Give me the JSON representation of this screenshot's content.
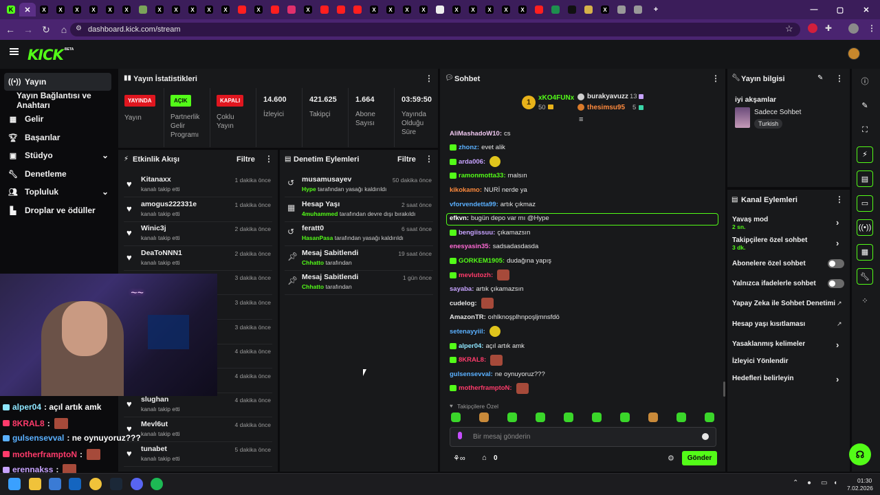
{
  "browser": {
    "url": "dashboard.kick.com/stream"
  },
  "sidebar": {
    "items": [
      {
        "label": "Yayın",
        "icon": "broadcast-icon"
      },
      {
        "label": "Yayın Bağlantısı ve Anahtarı",
        "icon": ""
      },
      {
        "label": "Gelir",
        "icon": "revenue-icon"
      },
      {
        "label": "Başarılar",
        "icon": "trophy-icon"
      },
      {
        "label": "Stüdyo",
        "icon": "studio-icon"
      },
      {
        "label": "Denetleme",
        "icon": "wrench-icon"
      },
      {
        "label": "Topluluk",
        "icon": "community-icon"
      },
      {
        "label": "Droplar ve ödüller",
        "icon": "drops-icon"
      }
    ]
  },
  "stats": {
    "title": "Yayın İstatistikleri",
    "badges": [
      {
        "badge": "YAYINDA",
        "label": "Yayın",
        "color": "#e0161f"
      },
      {
        "badge": "AÇIK",
        "label": "Partnerlik Gelir Programı",
        "color": "#53fc18"
      },
      {
        "badge": "KAPALI",
        "label": "Çoklu Yayın",
        "color": "#e0161f"
      }
    ],
    "numbers": [
      {
        "value": "14.600",
        "label": "İzleyici"
      },
      {
        "value": "421.625",
        "label": "Takipçi"
      },
      {
        "value": "1.664",
        "label": "Abone Sayısı"
      },
      {
        "value": "03:59:50",
        "label": "Yayında Olduğu Süre"
      }
    ]
  },
  "activity": {
    "title": "Etkinlik Akışı",
    "filter": "Filtre",
    "rows": [
      {
        "name": "Kitanaxx",
        "sub": "kanalı takip etti",
        "time": "1 dakika önce"
      },
      {
        "name": "amogus222331e",
        "sub": "kanalı takip etti",
        "time": "1 dakika önce"
      },
      {
        "name": "Winic3j",
        "sub": "kanalı takip etti",
        "time": "2 dakika önce"
      },
      {
        "name": "DeaToNNN1",
        "sub": "kanalı takip etti",
        "time": "2 dakika önce"
      },
      {
        "name": "",
        "sub": "",
        "time": "3 dakika önce"
      },
      {
        "name": "",
        "sub": "",
        "time": "3 dakika önce"
      },
      {
        "name": "",
        "sub": "",
        "time": "3 dakika önce"
      },
      {
        "name": "",
        "sub": "",
        "time": "4 dakika önce"
      },
      {
        "name": "",
        "sub": "",
        "time": "4 dakika önce"
      },
      {
        "name": "slughan",
        "sub": "kanalı takip etti",
        "time": "4 dakika önce"
      },
      {
        "name": "Mevl6ut",
        "sub": "kanalı takip etti",
        "time": "4 dakika önce"
      },
      {
        "name": "tunabet",
        "sub": "kanalı takip etti",
        "time": "5 dakika önce"
      }
    ]
  },
  "moderation": {
    "title": "Denetim Eylemleri",
    "filter": "Filtre",
    "rows": [
      {
        "name": "musamusayev",
        "actor": "Hype",
        "sub": "tarafından yasağı kaldırıldı",
        "time": "50 dakika önce",
        "icon": "undo-icon"
      },
      {
        "name": "Hesap Yaşı",
        "actor": "4muhammed",
        "sub": "tarafından devre dışı bırakıldı",
        "time": "2 saat önce",
        "icon": "calendar-icon"
      },
      {
        "name": "feratt0",
        "actor": "HasanPasa",
        "sub": "tarafından yasağı kaldırıldı",
        "time": "6 saat önce",
        "icon": "undo-icon"
      },
      {
        "name": "Mesaj Sabitlendi",
        "actor": "Chhatto",
        "sub": "tarafından",
        "time": "19 saat önce",
        "icon": "pin-icon"
      },
      {
        "name": "Mesaj Sabitlendi",
        "actor": "Chhatto",
        "sub": "tarafından",
        "time": "1 gün önce",
        "icon": "pin-icon"
      }
    ]
  },
  "chat": {
    "title": "Sohbet",
    "top_gifter": {
      "name": "xKO4FUNx",
      "count": "50"
    },
    "gifters": [
      {
        "name": "burakyavuzz",
        "count": "13"
      },
      {
        "name": "thesimsu95",
        "count": "5"
      }
    ],
    "messages": [
      {
        "user": "AliMashadoW10:",
        "text": "cs",
        "color": "#f0c8f0",
        "badge": false,
        "emote": ""
      },
      {
        "user": "zhonz:",
        "text": "evet alik",
        "color": "#5ab0ff",
        "badge": true,
        "emote": ""
      },
      {
        "user": "arda006:",
        "text": "",
        "color": "#c7a3ff",
        "badge": true,
        "emote": "yellow"
      },
      {
        "user": "ramonmotta33:",
        "text": "malsın",
        "color": "#53fc18",
        "badge": true,
        "emote": ""
      },
      {
        "user": "kikokamo:",
        "text": "NURİ nerde ya",
        "color": "#ff8a3d",
        "badge": false,
        "emote": ""
      },
      {
        "user": "vforvendetta99:",
        "text": "artık çıkmaz",
        "color": "#5ab0ff",
        "badge": false,
        "emote": ""
      },
      {
        "user": "efkvn:",
        "text": "bugün depo var mı @Hype",
        "color": "#ffffff",
        "badge": false,
        "emote": ""
      },
      {
        "user": "bengiissuu:",
        "text": "çıkamazsın",
        "color": "#c7a3ff",
        "badge": true,
        "emote": ""
      },
      {
        "user": "enesyasin35:",
        "text": "sadsadasdasda",
        "color": "#ff6ad5",
        "badge": false,
        "emote": ""
      },
      {
        "user": "GORKEM1905:",
        "text": "dudağına yapış",
        "color": "#53fc18",
        "badge": true,
        "emote": ""
      },
      {
        "user": "mevlutozh:",
        "text": "",
        "color": "#ff3b6b",
        "badge": true,
        "emote": "red"
      },
      {
        "user": "sayaba:",
        "text": "artık çıkamazsın",
        "color": "#c7a3ff",
        "badge": false,
        "emote": ""
      },
      {
        "user": "cudelog:",
        "text": "",
        "color": "#e6e6e6",
        "badge": false,
        "emote": "red"
      },
      {
        "user": "AmazonTR:",
        "text": "oıhlknoşplhnpoşljmnsfdö",
        "color": "#e6e6e6",
        "badge": false,
        "emote": ""
      },
      {
        "user": "setenayyiil:",
        "text": "",
        "color": "#5ab0ff",
        "badge": false,
        "emote": "yellow"
      },
      {
        "user": "alper04:",
        "text": "açıl artık amk",
        "color": "#8ee6ff",
        "badge": true,
        "emote": ""
      },
      {
        "user": "8KRAL8:",
        "text": "",
        "color": "#ff3b6b",
        "badge": true,
        "emote": "red"
      },
      {
        "user": "gulsensevval:",
        "text": "ne oynuyoruz???",
        "color": "#5ab0ff",
        "badge": false,
        "emote": ""
      },
      {
        "user": "motherframptoN:",
        "text": "",
        "color": "#ff3b6b",
        "badge": true,
        "emote": "red"
      }
    ],
    "followers_only_label": "Takipçilere Özel",
    "input_placeholder": "Bir mesaj gönderin",
    "send": "Gönder",
    "points": "0"
  },
  "stream_info": {
    "title": "Yayın bilgisi",
    "stream_title": "iyi akşamlar",
    "category": "Sadece Sohbet",
    "language": "Turkish"
  },
  "channel_actions": {
    "title": "Kanal Eylemleri",
    "items": [
      {
        "label": "Yavaş mod",
        "sub": "2 sn.",
        "control": "chevron"
      },
      {
        "label": "Takipçilere özel sohbet",
        "sub": "3 dk.",
        "control": "chevron"
      },
      {
        "label": "Abonelere özel sohbet",
        "sub": "",
        "control": "toggle"
      },
      {
        "label": "Yalnızca ifadelerle sohbet",
        "sub": "",
        "control": "toggle"
      },
      {
        "label": "Yapay Zeka ile Sohbet Denetimi",
        "sub": "",
        "control": "external"
      },
      {
        "label": "Hesap yaşı kısıtlaması",
        "sub": "",
        "control": "external"
      },
      {
        "label": "Yasaklanmış kelimeler",
        "sub": "",
        "control": "chevron"
      },
      {
        "label": "İzleyici Yönlendir",
        "sub": "",
        "control": "none"
      },
      {
        "label": "Hedefleri belirleyin",
        "sub": "",
        "control": "chevron"
      }
    ]
  },
  "overlay_chat": [
    {
      "user": "alper04",
      "text": ": açıl artık amk",
      "color": "#8ee6ff",
      "emote": false
    },
    {
      "user": "8KRAL8",
      "text": ":",
      "color": "#ff3b6b",
      "emote": true
    },
    {
      "user": "gulsensevval",
      "text": ": ne oynuyoruz???",
      "color": "#5ab0ff",
      "emote": false
    },
    {
      "user": "motherframptoN",
      "text": ":",
      "color": "#ff3b6b",
      "emote": true
    },
    {
      "user": "erennakss",
      "text": ":",
      "color": "#c7a3ff",
      "emote": true
    }
  ],
  "taskbar": {
    "time": "01:30",
    "date": "7.02.2026"
  },
  "colors": {
    "accent": "#53fc18",
    "panel": "#18191b",
    "live": "#e0161f"
  }
}
